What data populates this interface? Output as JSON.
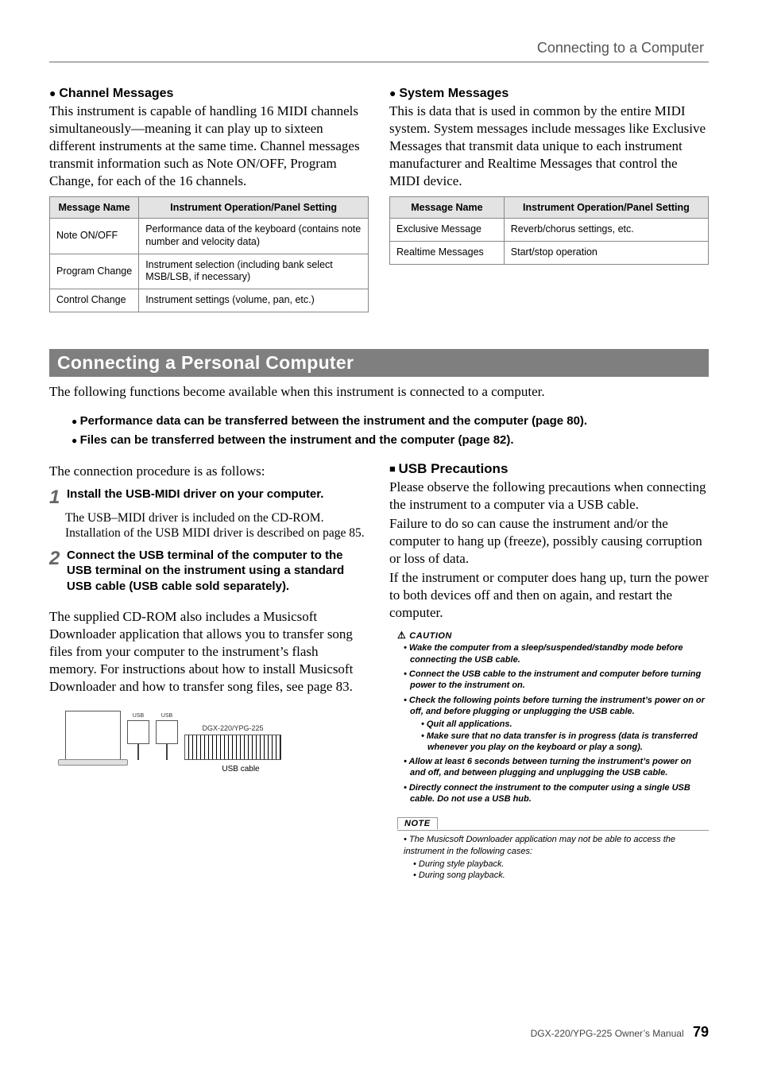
{
  "header": {
    "breadcrumb": "Connecting to a Computer"
  },
  "left_top": {
    "heading": "Channel Messages",
    "body": "This instrument is capable of handling 16 MIDI channels simultaneously—meaning it can play up to sixteen different instruments at the same time. Channel messages transmit information such as Note ON/OFF, Program Change, for each of the 16 channels.",
    "table": {
      "headers": [
        "Message Name",
        "Instrument Operation/Panel Setting"
      ],
      "rows": [
        [
          "Note ON/OFF",
          "Performance data of the keyboard (contains note number and velocity data)"
        ],
        [
          "Program Change",
          "Instrument selection (including bank select MSB/LSB, if necessary)"
        ],
        [
          "Control Change",
          "Instrument settings (volume, pan, etc.)"
        ]
      ]
    }
  },
  "right_top": {
    "heading": "System Messages",
    "body": "This is data that is used in common by the entire MIDI system. System messages include messages like Exclusive Messages that transmit data unique to each instrument manufacturer and Realtime Messages that control the MIDI device.",
    "table": {
      "headers": [
        "Message Name",
        "Instrument Operation/Panel Setting"
      ],
      "rows": [
        [
          "Exclusive Message",
          "Reverb/chorus settings, etc."
        ],
        [
          "Realtime Messages",
          "Start/stop operation"
        ]
      ]
    }
  },
  "section": {
    "title": "Connecting a Personal Computer",
    "intro": "The following functions become available when this instrument is connected to a computer.",
    "bullets": [
      "Performance data can be transferred between the instrument and the computer (page 80).",
      "Files can be transferred between the instrument and the computer (page 82)."
    ],
    "proc_intro": "The connection procedure is as follows:",
    "step1": {
      "num": "1",
      "title": "Install the USB-MIDI driver on your computer.",
      "body": "The USB–MIDI driver is included on the CD-ROM. Installation of the USB MIDI driver is described on page 85."
    },
    "step2": {
      "num": "2",
      "title": "Connect the USB terminal of the computer to the USB terminal on the instrument using a standard USB cable (USB cable sold separately)."
    },
    "para": "The supplied CD-ROM also includes a Musicsoft Downloader application that allows you to transfer song files from your computer to the instrument’s flash memory. For instructions about how to install Musicsoft Downloader and how to transfer song files, see page 83.",
    "diagram": {
      "cable_label": "USB cable",
      "keyboard_label": "DGX-220/YPG-225"
    },
    "usb": {
      "heading": "USB Precautions",
      "p1": "Please observe the following precautions when connecting the instrument to a computer via a USB cable.",
      "p2": "Failure to do so can cause the instrument and/or the computer to hang up (freeze), possibly causing corruption or loss of data.",
      "p3": "If the instrument or computer does hang up, turn the power to both devices off and then on again, and restart the computer.",
      "caution_label": "CAUTION",
      "cautions": [
        "Wake the computer from a sleep/suspended/standby mode before connecting the USB cable.",
        "Connect the USB cable to the instrument and computer before turning power to the instrument on.",
        "Check the following points before turning the instrument’s power on or off, and before plugging or unplugging the USB cable.",
        "Allow at least 6 seconds between turning the instrument’s power on and off, and between plugging and unplugging the USB cable.",
        "Directly connect the instrument to the computer using a single USB cable. Do not use a USB hub."
      ],
      "caution_sub": [
        "Quit all applications.",
        "Make sure that no data transfer is in progress (data is transferred whenever you play on the keyboard or play a song)."
      ],
      "note_label": "NOTE",
      "note_intro": "The Musicsoft Downloader application may not be able to access the instrument in the following cases:",
      "note_items": [
        "During style playback.",
        "During song playback."
      ]
    }
  },
  "footer": {
    "model": "DGX-220/YPG-225  Owner’s Manual",
    "page": "79"
  }
}
